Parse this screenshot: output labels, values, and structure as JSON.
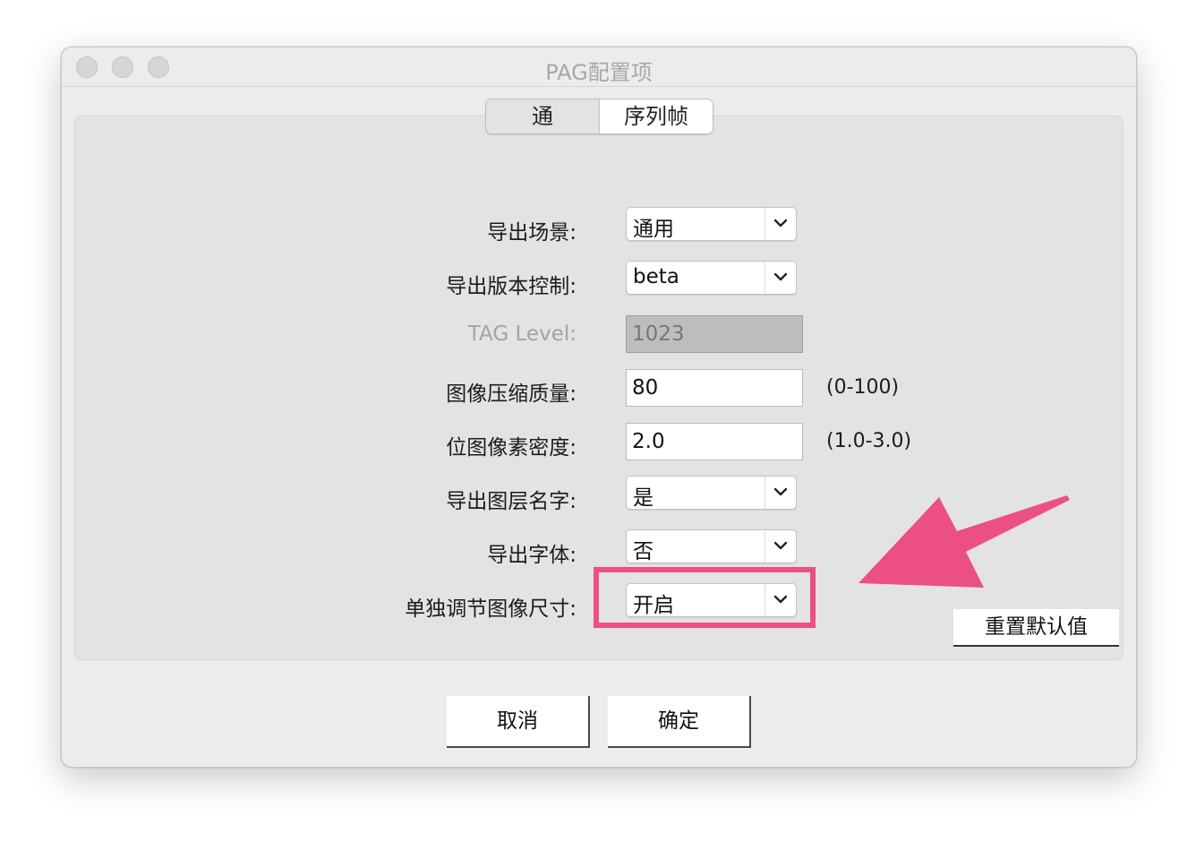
{
  "window": {
    "title": "PAG配置项"
  },
  "tabs": [
    {
      "label": "通用"
    },
    {
      "label": "序列帧"
    }
  ],
  "form": {
    "export_scene": {
      "label": "导出场景:",
      "value": "通用"
    },
    "version_control": {
      "label": "导出版本控制:",
      "value": "beta"
    },
    "tag_level": {
      "label": "TAG Level:",
      "value": "1023"
    },
    "image_quality": {
      "label": "图像压缩质量:",
      "value": "80",
      "hint": "(0-100)"
    },
    "bitmap_density": {
      "label": "位图像素密度:",
      "value": "2.0",
      "hint": "(1.0-3.0)"
    },
    "layer_names": {
      "label": "导出图层名字:",
      "value": "是"
    },
    "export_fonts": {
      "label": "导出字体:",
      "value": "否"
    },
    "separate_size": {
      "label": "单独调节图像尺寸:",
      "value": "开启"
    }
  },
  "buttons": {
    "reset": "重置默认值",
    "cancel": "取消",
    "ok": "确定"
  },
  "annotation": {
    "highlight_color": "#ec4f82"
  },
  "icons": [
    "chevron-down-icon",
    "arrow-annotation-icon"
  ]
}
